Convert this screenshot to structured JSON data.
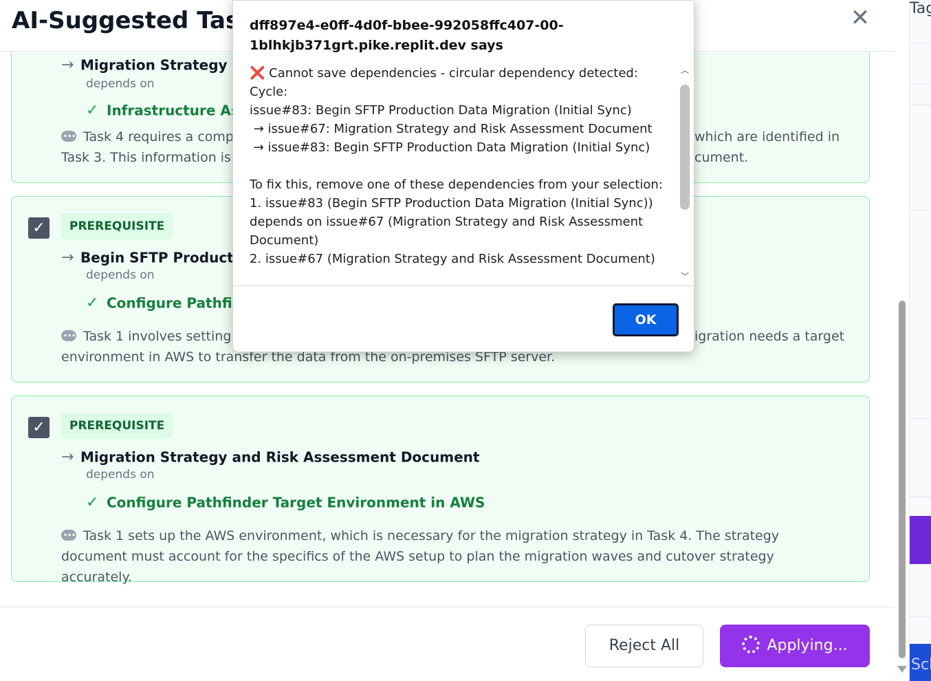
{
  "background": {
    "tag_text": "Tag",
    "footer_text": "Sch"
  },
  "modal": {
    "title": "AI-Suggested Task",
    "close_label": "✕"
  },
  "cards": [
    {
      "task": "Migration Strategy and",
      "depends_on_label": "depends on",
      "dependency": "Infrastructure Asses",
      "reason": "Task 4 requires a compr... which are identified in Task 3. This information is c... cument.",
      "reason_left": "Task 4 requires a compr",
      "reason_right": "which are identified in",
      "reason_line2_left": "Task 3. This information is c",
      "reason_line2_right": "cument."
    },
    {
      "badge": "PREREQUISITE",
      "task": "Begin SFTP Production",
      "depends_on_label": "depends on",
      "dependency": "Configure Pathfinde",
      "reason_left": "Task 1 involves setting u",
      "reason_right": "igration needs a target",
      "reason_line2": "environment in AWS to transfer the data from the on-premises SFTP server."
    },
    {
      "badge": "PREREQUISITE",
      "task": "Migration Strategy and Risk Assessment Document",
      "depends_on_label": "depends on",
      "dependency": "Configure Pathfinder Target Environment in AWS",
      "reason": "Task 1 sets up the AWS environment, which is necessary for the migration strategy in Task 4. The strategy document must account for the specifics of the AWS setup to plan the migration waves and cutover strategy accurately."
    }
  ],
  "footer": {
    "reject_label": "Reject All",
    "apply_label": "Applying..."
  },
  "alert": {
    "title": "dff897e4-e0ff-4d0f-bbee-992058ffc407-00-1blhkjb371grt.pike.replit.dev says",
    "error_icon": "❌",
    "message_line1": "Cannot save dependencies - circular dependency detected:",
    "message_body": "\nCycle:\nissue#83: Begin SFTP Production Data Migration (Initial Sync)\n → issue#67: Migration Strategy and Risk Assessment Document\n → issue#83: Begin SFTP Production Data Migration (Initial Sync)\n\nTo fix this, remove one of these dependencies from your selection:\n1. issue#83 (Begin SFTP Production Data Migration (Initial Sync)) depends on issue#67 (Migration Strategy and Risk Assessment Document)\n2. issue#67 (Migration Strategy and Risk Assessment Document)",
    "ok_label": "OK"
  },
  "colors": {
    "accent_purple": "#9333ea",
    "card_bg": "#f0fdf4",
    "card_border": "#86efac",
    "ok_blue": "#0b63e5"
  }
}
